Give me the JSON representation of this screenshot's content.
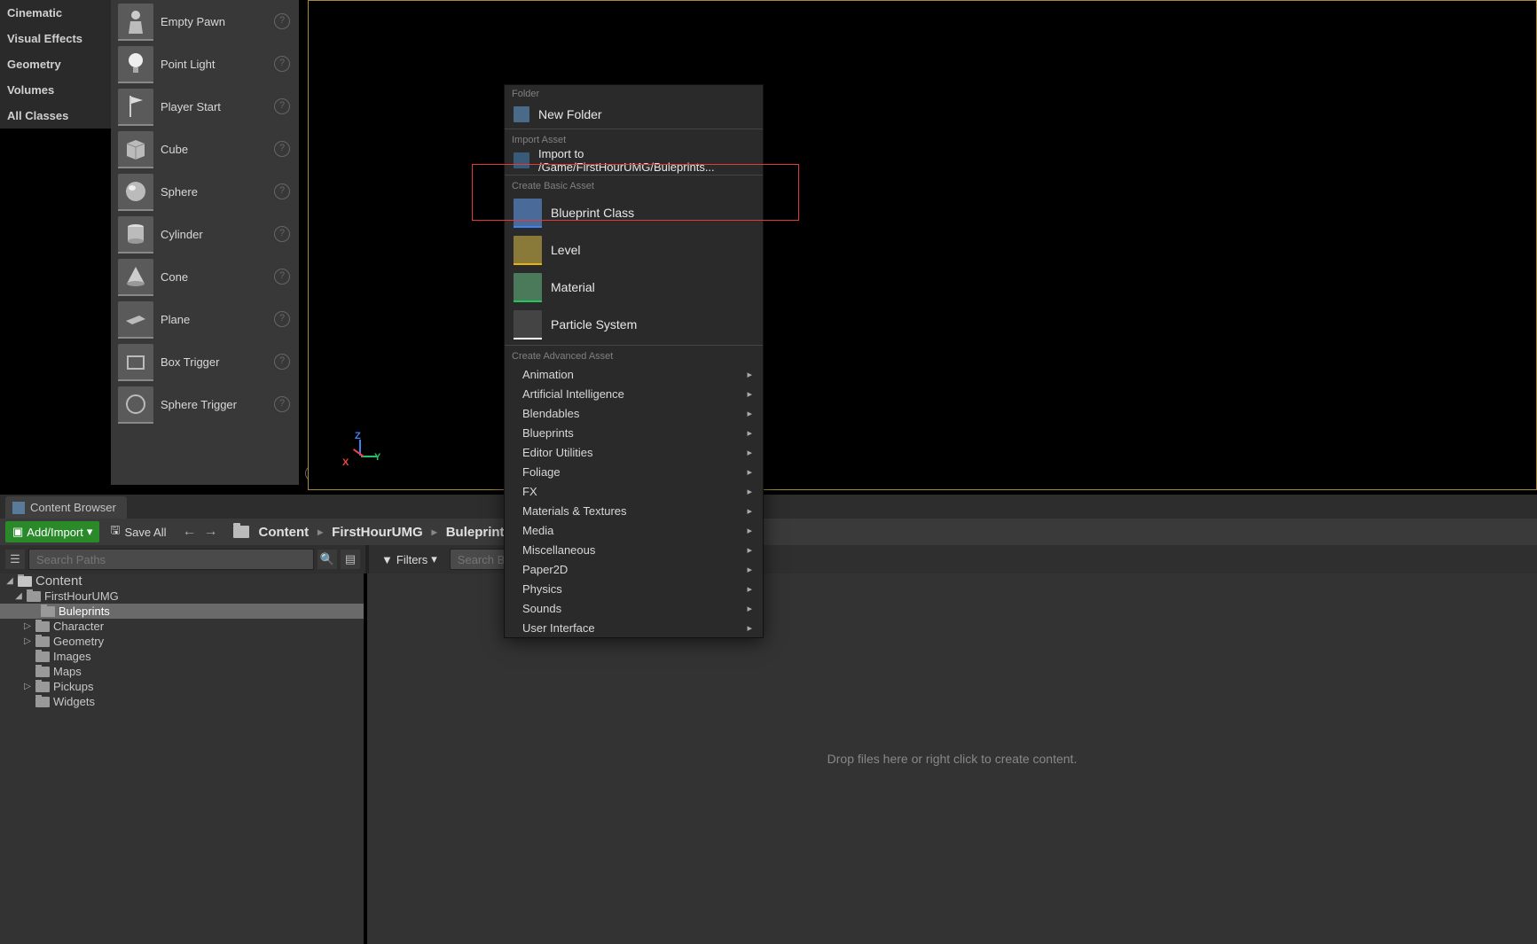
{
  "categories": [
    "Cinematic",
    "Visual Effects",
    "Geometry",
    "Volumes",
    "All Classes"
  ],
  "actors": [
    {
      "label": "Empty Pawn",
      "icon": "pawn"
    },
    {
      "label": "Point Light",
      "icon": "light"
    },
    {
      "label": "Player Start",
      "icon": "flag"
    },
    {
      "label": "Cube",
      "icon": "cube"
    },
    {
      "label": "Sphere",
      "icon": "sphere"
    },
    {
      "label": "Cylinder",
      "icon": "cylinder"
    },
    {
      "label": "Cone",
      "icon": "cone"
    },
    {
      "label": "Plane",
      "icon": "plane"
    },
    {
      "label": "Box Trigger",
      "icon": "box-trigger"
    },
    {
      "label": "Sphere Trigger",
      "icon": "sphere-trigger"
    }
  ],
  "axis": {
    "x": "X",
    "y": "Y",
    "z": "Z"
  },
  "content_browser": {
    "tab_label": "Content Browser",
    "add_import": "Add/Import",
    "save_all": "Save All",
    "breadcrumbs": [
      "Content",
      "FirstHourUMG",
      "Buleprints"
    ],
    "search_paths_placeholder": "Search Paths",
    "filters_label": "Filters",
    "search_assets_placeholder": "Search Bulep",
    "drop_hint": "Drop files here or right click to create content.",
    "tree": {
      "root": "Content",
      "children": [
        {
          "name": "FirstHourUMG",
          "expanded": true,
          "children": [
            {
              "name": "Buleprints",
              "selected": true
            },
            {
              "name": "Character",
              "has_children": true
            },
            {
              "name": "Geometry",
              "has_children": true
            },
            {
              "name": "Images"
            },
            {
              "name": "Maps"
            },
            {
              "name": "Pickups",
              "has_children": true
            },
            {
              "name": "Widgets"
            }
          ]
        }
      ]
    }
  },
  "context_menu": {
    "sections": {
      "folder": {
        "label": "Folder",
        "items": [
          {
            "label": "New Folder",
            "icon": "folder-plus"
          }
        ]
      },
      "import": {
        "label": "Import Asset",
        "items": [
          {
            "label": "Import to /Game/FirstHourUMG/Buleprints...",
            "icon": "import"
          }
        ]
      },
      "basic": {
        "label": "Create Basic Asset",
        "items": [
          {
            "label": "Blueprint Class",
            "icon": "blueprint",
            "accent": "#3b82f6",
            "highlighted": true
          },
          {
            "label": "Level",
            "icon": "level",
            "accent": "#eab308"
          },
          {
            "label": "Material",
            "icon": "material",
            "accent": "#22c55e"
          },
          {
            "label": "Particle System",
            "icon": "particle",
            "accent": "#ffffff"
          }
        ]
      },
      "advanced": {
        "label": "Create Advanced Asset",
        "items": [
          {
            "label": "Animation"
          },
          {
            "label": "Artificial Intelligence"
          },
          {
            "label": "Blendables"
          },
          {
            "label": "Blueprints"
          },
          {
            "label": "Editor Utilities"
          },
          {
            "label": "Foliage"
          },
          {
            "label": "FX"
          },
          {
            "label": "Materials & Textures"
          },
          {
            "label": "Media"
          },
          {
            "label": "Miscellaneous"
          },
          {
            "label": "Paper2D"
          },
          {
            "label": "Physics"
          },
          {
            "label": "Sounds"
          },
          {
            "label": "User Interface"
          }
        ]
      }
    }
  }
}
